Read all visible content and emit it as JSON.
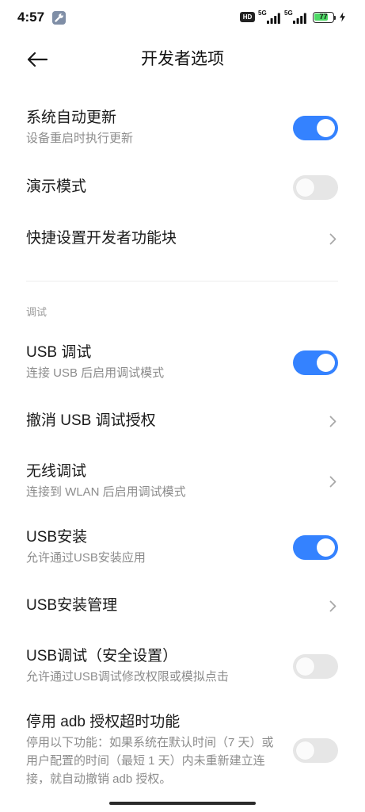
{
  "theme": {
    "accent": "#3482ff",
    "toggle_off": "#e6e6e6"
  },
  "status_bar": {
    "time": "4:57",
    "notification_icon": "wrench-icon",
    "hd_label": "HD",
    "sim1_network": "5G",
    "sim2_network": "5G",
    "battery_level": "77",
    "charging_icon": "charging-bolt-icon"
  },
  "header": {
    "back_icon": "back-arrow-icon",
    "title": "开发者选项"
  },
  "general_items": [
    {
      "title": "系统自动更新",
      "subtitle": "设备重启时执行更新",
      "toggle_on": true
    },
    {
      "title": "演示模式",
      "toggle_on": false
    },
    {
      "title": "快捷设置开发者功能块",
      "trailing_icon": "chevron-right-icon"
    }
  ],
  "debug_section": {
    "header": "调试",
    "items": [
      {
        "title": "USB 调试",
        "subtitle": "连接 USB 后启用调试模式",
        "toggle_on": true
      },
      {
        "title": "撤消 USB 调试授权",
        "trailing_icon": "chevron-right-icon"
      },
      {
        "title": "无线调试",
        "subtitle": "连接到 WLAN 后启用调试模式",
        "trailing_icon": "chevron-right-icon"
      },
      {
        "title": "USB安装",
        "subtitle": "允许通过USB安装应用",
        "toggle_on": true
      },
      {
        "title": "USB安装管理",
        "trailing_icon": "chevron-right-icon"
      },
      {
        "title": "USB调试（安全设置）",
        "subtitle": "允许通过USB调试修改权限或模拟点击",
        "toggle_on": false
      },
      {
        "title": "停用 adb 授权超时功能",
        "subtitle": "停用以下功能：如果系统在默认时间（7 天）或用户配置的时间（最短 1 天）内未重新建立连接，就自动撤销 adb 授权。",
        "toggle_on": false
      }
    ]
  }
}
